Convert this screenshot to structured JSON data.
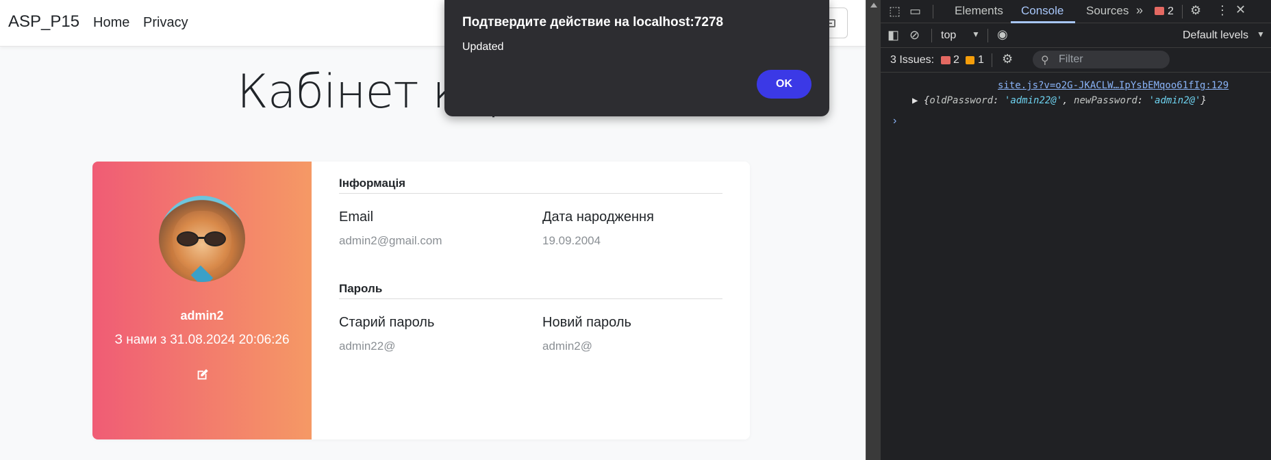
{
  "navbar": {
    "brand": "ASP_P15",
    "links": [
      "Home",
      "Privacy"
    ]
  },
  "page": {
    "title": "Кабінет кор"
  },
  "profile": {
    "username": "admin2",
    "member_since": "З нами з 31.08.2024 20:06:26",
    "edit_icon": "edit-icon"
  },
  "info_section": {
    "title": "Інформація",
    "email_label": "Email",
    "email_value": "admin2@gmail.com",
    "birth_label": "Дата народження",
    "birth_value": "19.09.2004"
  },
  "password_section": {
    "title": "Пароль",
    "old_label": "Старий пароль",
    "old_value": "admin22@",
    "new_label": "Новий пароль",
    "new_value": "admin2@"
  },
  "dialog": {
    "title": "Подтвердите действие на localhost:7278",
    "message": "Updated",
    "ok_label": "OK"
  },
  "devtools": {
    "tabs": [
      "Elements",
      "Console",
      "Sources"
    ],
    "active_tab": "Console",
    "error_count": "2",
    "context": "top",
    "filter_placeholder": "Filter",
    "levels": "Default levels",
    "issues_label": "3 Issues:",
    "issues_errors": "2",
    "issues_warnings": "1",
    "console_link": "site.js?v=o2G-JKACLW…IpYsbEMqoo61fIg:129",
    "console_object": {
      "old_key": "oldPassword",
      "old_value": "'admin22@'",
      "new_key": "newPassword",
      "new_value": "'admin2@'"
    },
    "accent_color": "#a8c7fa"
  }
}
